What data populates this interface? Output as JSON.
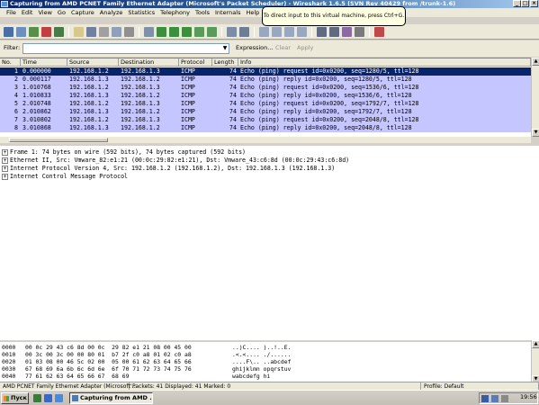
{
  "window": {
    "title": "Capturing from AMD PCNET Family Ethernet Adapter (Microsoft's Packet Scheduler) - Wireshark 1.6.5 (SVN Rev 40429 from /trunk-1.6)",
    "min_glyph": "_",
    "max_glyph": "□",
    "close_glyph": "×"
  },
  "menu": [
    "File",
    "Edit",
    "View",
    "Go",
    "Capture",
    "Analyze",
    "Statistics",
    "Telephony",
    "Tools",
    "Internals",
    "Help"
  ],
  "tooltip": "To direct input to this virtual machine, press Ctrl+G.",
  "filter": {
    "label": "Filter:",
    "value": "",
    "dropdown_glyph": "▼",
    "expression_label": "Expression...",
    "clear_label": "Clear",
    "apply_label": "Apply"
  },
  "packet_list": {
    "columns": [
      "No.",
      "Time",
      "Source",
      "Destination",
      "Protocol",
      "Length",
      "Info"
    ],
    "rows": [
      {
        "no": "1",
        "time": "0.000000",
        "src": "192.168.1.2",
        "dst": "192.168.1.3",
        "proto": "ICMP",
        "len": "74",
        "info": "Echo (ping) request  id=0x0200, seq=1280/5, ttl=128",
        "selected": true
      },
      {
        "no": "2",
        "time": "0.000117",
        "src": "192.168.1.3",
        "dst": "192.168.1.2",
        "proto": "ICMP",
        "len": "74",
        "info": "Echo (ping) reply    id=0x0200, seq=1280/5, ttl=128",
        "selected": false
      },
      {
        "no": "3",
        "time": "1.010768",
        "src": "192.168.1.2",
        "dst": "192.168.1.3",
        "proto": "ICMP",
        "len": "74",
        "info": "Echo (ping) request  id=0x0200, seq=1536/6, ttl=128",
        "selected": false
      },
      {
        "no": "4",
        "time": "1.010833",
        "src": "192.168.1.3",
        "dst": "192.168.1.2",
        "proto": "ICMP",
        "len": "74",
        "info": "Echo (ping) reply    id=0x0200, seq=1536/6, ttl=128",
        "selected": false
      },
      {
        "no": "5",
        "time": "2.010748",
        "src": "192.168.1.2",
        "dst": "192.168.1.3",
        "proto": "ICMP",
        "len": "74",
        "info": "Echo (ping) request  id=0x0200, seq=1792/7, ttl=128",
        "selected": false
      },
      {
        "no": "6",
        "time": "2.010862",
        "src": "192.168.1.3",
        "dst": "192.168.1.2",
        "proto": "ICMP",
        "len": "74",
        "info": "Echo (ping) reply    id=0x0200, seq=1792/7, ttl=128",
        "selected": false
      },
      {
        "no": "7",
        "time": "3.010802",
        "src": "192.168.1.2",
        "dst": "192.168.1.3",
        "proto": "ICMP",
        "len": "74",
        "info": "Echo (ping) request  id=0x0200, seq=2048/8, ttl=128",
        "selected": false
      },
      {
        "no": "8",
        "time": "3.010868",
        "src": "192.168.1.3",
        "dst": "192.168.1.2",
        "proto": "ICMP",
        "len": "74",
        "info": "Echo (ping) reply    id=0x0200, seq=2048/8, ttl=128",
        "selected": false
      }
    ]
  },
  "details": [
    "Frame 1: 74 bytes on wire (592 bits), 74 bytes captured (592 bits)",
    "Ethernet II, Src: Vmware_82:e1:21 (00:0c:29:82:e1:21), Dst: Vmware_43:c6:8d (00:0c:29:43:c6:8d)",
    "Internet Protocol Version 4, Src: 192.168.1.2 (192.168.1.2), Dst: 192.168.1.3 (192.168.1.3)",
    "Internet Control Message Protocol"
  ],
  "expand_glyph": "+",
  "bytes": [
    {
      "offset": "0000",
      "hex": "00 0c 29 43 c6 8d 00 0c  29 82 e1 21 08 00 45 00",
      "ascii": "..)C.... )..!..E."
    },
    {
      "offset": "0010",
      "hex": "00 3c 00 3c 00 00 80 01  b7 2f c0 a8 01 02 c0 a8",
      "ascii": ".<.<.... ./......"
    },
    {
      "offset": "0020",
      "hex": "01 03 08 00 46 5c 02 00  05 00 61 62 63 64 65 66",
      "ascii": "....F\\.. ..abcdef"
    },
    {
      "offset": "0030",
      "hex": "67 68 69 6a 6b 6c 6d 6e  6f 70 71 72 73 74 75 76",
      "ascii": "ghijklmn opqrstuv"
    },
    {
      "offset": "0040",
      "hex": "77 61 62 63 64 65 66 67  68 69",
      "ascii": "wabcdefg hi"
    }
  ],
  "status": {
    "interface": "AMD PCNET Family Ethernet Adapter (Microsoft'...",
    "packets": "Packets: 41 Displayed: 41 Marked: 0",
    "profile": "Profile: Default"
  },
  "taskbar": {
    "start_label": "Пуск",
    "task_label": "Capturing from AMD ...",
    "clock": "19:56"
  }
}
